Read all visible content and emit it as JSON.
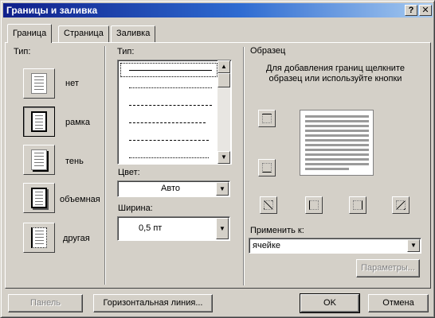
{
  "window": {
    "title": "Границы и заливка",
    "help_glyph": "?",
    "close_glyph": "✕"
  },
  "tabs": [
    {
      "label": "Граница",
      "active": true
    },
    {
      "label": "Страница",
      "active": false
    },
    {
      "label": "Заливка",
      "active": false
    }
  ],
  "border_type": {
    "heading": "Тип:",
    "options": [
      {
        "label": "нет",
        "icon": "no-border-icon",
        "selected": false
      },
      {
        "label": "рамка",
        "icon": "box-border-icon",
        "selected": true
      },
      {
        "label": "тень",
        "icon": "shadow-border-icon",
        "selected": false
      },
      {
        "label": "объемная",
        "icon": "3d-border-icon",
        "selected": false
      },
      {
        "label": "другая",
        "icon": "custom-border-icon",
        "selected": false
      }
    ]
  },
  "line_style": {
    "heading": "Тип:",
    "styles": [
      "solid",
      "dotted-fine",
      "dashed-short",
      "dashed",
      "dash-dot"
    ],
    "selected_index": 0
  },
  "color": {
    "label": "Цвет:",
    "value": "Авто"
  },
  "width": {
    "label": "Ширина:",
    "value": "0,5 пт"
  },
  "preview": {
    "heading": "Образец",
    "instructions": "Для добавления границ щелкните образец или используйте кнопки"
  },
  "apply_to": {
    "label": "Применить к:",
    "value": "ячейке"
  },
  "buttons": {
    "options": "Параметры...",
    "toolbar": "Панель",
    "horizontal_line": "Горизонтальная линия...",
    "ok": "OK",
    "cancel": "Отмена"
  }
}
